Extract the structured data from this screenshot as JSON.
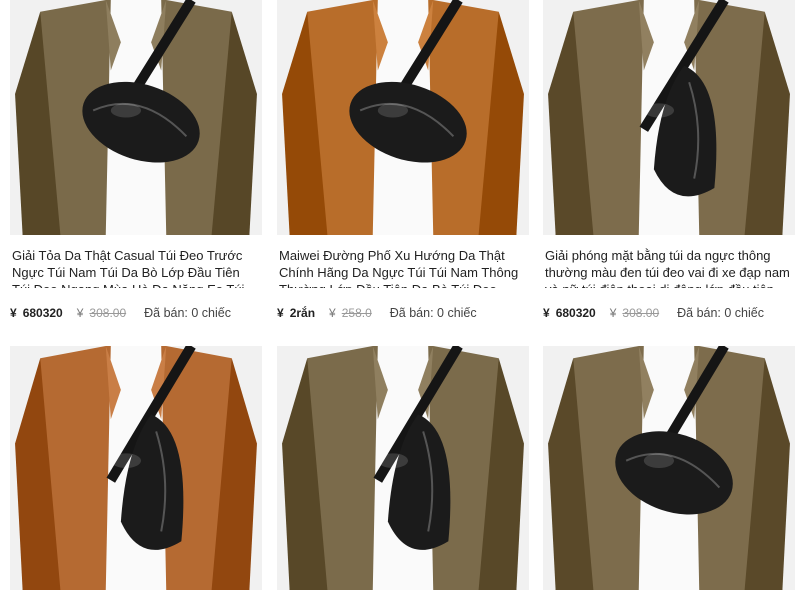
{
  "products": [
    {
      "title": "Giải Tỏa Da Thật Casual Túi Đeo Trước Ngực Túi Nam Túi Da Bò Lớp Đầu Tiên Túi Đeo Ngang Mùa Hè Đa Năng Eo Túi Nhỏ",
      "currency": "¥",
      "price": "680320",
      "old_price": "308.00",
      "sold": "Đã bán: 0 chiếc",
      "shirt_color": "#7a6a4a",
      "bag_shape": "pouch"
    },
    {
      "title": "Maiwei Đường Phố Xu Hướng Da Thật Chính Hãng Da Ngực Túi Túi Nam Thông Thường Lớp Đầu Tiên Da Bò Túi Đeo",
      "currency": "¥",
      "price": "2rắn",
      "old_price": "258.0",
      "sold": "Đã bán: 0 chiếc",
      "shirt_color": "#b86d2a",
      "bag_shape": "pouch"
    },
    {
      "title": "Giải phóng mặt bằng túi da ngực thông thường màu đen túi đeo vai đi xe đạp nam và nữ túi điện thoại di động lớp đầu tiên túi",
      "currency": "¥",
      "price": "680320",
      "old_price": "308.00",
      "sold": "Đã bán: 0 chiếc",
      "shirt_color": "#7d6c4c",
      "bag_shape": "sling"
    },
    {
      "shirt_color": "#b56a32",
      "bag_shape": "sling"
    },
    {
      "shirt_color": "#7b6b4b",
      "bag_shape": "sling"
    },
    {
      "shirt_color": "#7d6c4c",
      "bag_shape": "pouch"
    }
  ]
}
